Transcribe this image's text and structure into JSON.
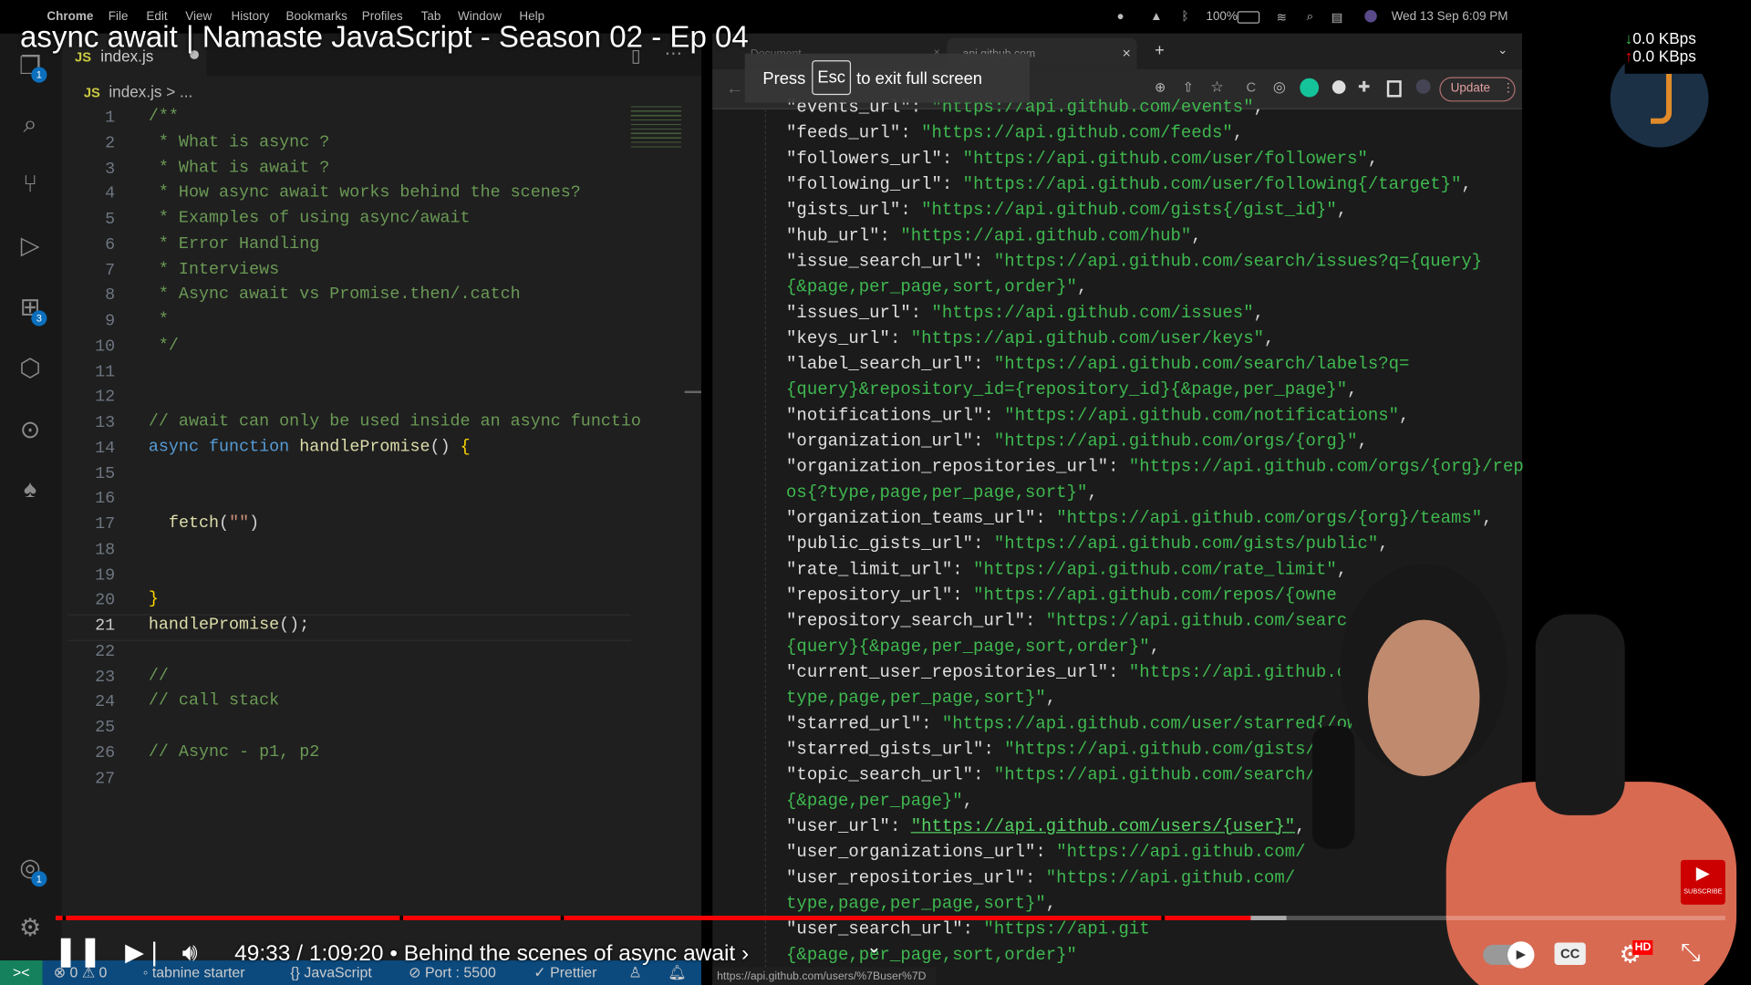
{
  "video": {
    "title": "async await | Namaste JavaScript - Season 02 - Ep 04",
    "time": "49:33 / 1:09:20",
    "chapter": "Behind the scenes of async await",
    "progress_percent": 71.6,
    "buffered_percent": 73.7,
    "accent": "#ff0000"
  },
  "menubar": {
    "items": [
      "Chrome",
      "File",
      "Edit",
      "View",
      "History",
      "Bookmarks",
      "Profiles",
      "Tab",
      "Window",
      "Help"
    ],
    "battery": "100%",
    "datetime": "Wed 13 Sep  6:09 PM"
  },
  "netspeed": {
    "down": "0.0 KBps",
    "up": "0.0 KBps"
  },
  "vscode": {
    "tab": "index.js",
    "tab_icon": "JS",
    "breadcrumb": "index.js > ...",
    "badges": {
      "explorer": "1",
      "extensions": "3",
      "accounts": "1"
    },
    "active_line": 21,
    "lines": [
      [
        [
          "/**",
          "comment"
        ]
      ],
      [
        [
          " * What is async ?",
          "comment"
        ]
      ],
      [
        [
          " * What is await ?",
          "comment"
        ]
      ],
      [
        [
          " * How async await works behind the scenes?",
          "comment"
        ]
      ],
      [
        [
          " * Examples of using async/await",
          "comment"
        ]
      ],
      [
        [
          " * Error Handling",
          "comment"
        ]
      ],
      [
        [
          " * Interviews",
          "comment"
        ]
      ],
      [
        [
          " * Async await vs Promise.then/.catch",
          "comment"
        ]
      ],
      [
        [
          " *",
          "comment"
        ]
      ],
      [
        [
          " */",
          "comment"
        ]
      ],
      [],
      [],
      [
        [
          "// await can only be used inside an async functio",
          "comment"
        ]
      ],
      [
        [
          "async",
          "kw"
        ],
        [
          " ",
          "plain"
        ],
        [
          "function",
          "kw"
        ],
        [
          " ",
          "plain"
        ],
        [
          "handlePromise",
          "fn"
        ],
        [
          "() ",
          "plain"
        ],
        [
          "{",
          "brace"
        ]
      ],
      [],
      [],
      [
        [
          "  ",
          "plain"
        ],
        [
          "fetch",
          "fn"
        ],
        [
          "(",
          "plain"
        ],
        [
          "\"\"",
          "str"
        ],
        [
          ")",
          "plain"
        ]
      ],
      [],
      [],
      [
        [
          "}",
          "brace"
        ]
      ],
      [
        [
          "handlePromise",
          "fn"
        ],
        [
          "();",
          "plain"
        ]
      ],
      [],
      [
        [
          "//",
          "comment"
        ]
      ],
      [
        [
          "// call stack",
          "comment"
        ]
      ],
      [],
      [
        [
          "// Async - p1, p2",
          "comment"
        ]
      ],
      []
    ],
    "status": {
      "remote": "><",
      "errors": "0",
      "warnings": "0",
      "tabnine": "tabnine starter",
      "language": "JavaScript",
      "port": "Port : 5500",
      "prettier": "Prettier"
    }
  },
  "chrome": {
    "tabs": [
      "Document",
      "api.github.com"
    ],
    "fullscreen_msg": {
      "press": "Press",
      "key": "Esc",
      "rest": "to exit full screen"
    },
    "update_label": "Update",
    "status_url": "https://api.github.com/users/%7Buser%7D",
    "json_lines": [
      {
        "k": "\"events_url\"",
        "v": "\"https://api.github.com/events\"",
        "t": ","
      },
      {
        "k": "\"feeds_url\"",
        "v": "\"https://api.github.com/feeds\"",
        "t": ","
      },
      {
        "k": "\"followers_url\"",
        "v": "\"https://api.github.com/user/followers\"",
        "t": ","
      },
      {
        "k": "\"following_url\"",
        "v": "\"https://api.github.com/user/following{/target}\"",
        "t": ","
      },
      {
        "k": "\"gists_url\"",
        "v": "\"https://api.github.com/gists{/gist_id}\"",
        "t": ","
      },
      {
        "k": "\"hub_url\"",
        "v": "\"https://api.github.com/hub\"",
        "t": ","
      },
      {
        "k": "\"issue_search_url\"",
        "v": "\"https://api.github.com/search/issues?q={query}",
        "t": ""
      },
      {
        "k": "",
        "v": "{&page,per_page,sort,order}\"",
        "t": ","
      },
      {
        "k": "\"issues_url\"",
        "v": "\"https://api.github.com/issues\"",
        "t": ","
      },
      {
        "k": "\"keys_url\"",
        "v": "\"https://api.github.com/user/keys\"",
        "t": ","
      },
      {
        "k": "\"label_search_url\"",
        "v": "\"https://api.github.com/search/labels?q=",
        "t": ""
      },
      {
        "k": "",
        "v": "{query}&repository_id={repository_id}{&page,per_page}\"",
        "t": ","
      },
      {
        "k": "\"notifications_url\"",
        "v": "\"https://api.github.com/notifications\"",
        "t": ","
      },
      {
        "k": "\"organization_url\"",
        "v": "\"https://api.github.com/orgs/{org}\"",
        "t": ","
      },
      {
        "k": "\"organization_repositories_url\"",
        "v": "\"https://api.github.com/orgs/{org}/rep",
        "t": ""
      },
      {
        "k": "",
        "v": "os{?type,page,per_page,sort}\"",
        "t": ","
      },
      {
        "k": "\"organization_teams_url\"",
        "v": "\"https://api.github.com/orgs/{org}/teams\"",
        "t": ","
      },
      {
        "k": "\"public_gists_url\"",
        "v": "\"https://api.github.com/gists/public\"",
        "t": ","
      },
      {
        "k": "\"rate_limit_url\"",
        "v": "\"https://api.github.com/rate_limit\"",
        "t": ","
      },
      {
        "k": "\"repository_url\"",
        "v": "\"https://api.github.com/repos/{owne",
        "t": ""
      },
      {
        "k": "\"repository_search_url\"",
        "v": "\"https://api.github.com/searc",
        "t": ""
      },
      {
        "k": "",
        "v": "{query}{&page,per_page,sort,order}\"",
        "t": ","
      },
      {
        "k": "\"current_user_repositories_url\"",
        "v": "\"https://api.github.co",
        "t": ""
      },
      {
        "k": "",
        "v": "type,page,per_page,sort}\"",
        "t": ","
      },
      {
        "k": "\"starred_url\"",
        "v": "\"https://api.github.com/user/starred{/owne",
        "t": ""
      },
      {
        "k": "\"starred_gists_url\"",
        "v": "\"https://api.github.com/gists/sta",
        "t": ""
      },
      {
        "k": "\"topic_search_url\"",
        "v": "\"https://api.github.com/search/t",
        "t": ""
      },
      {
        "k": "",
        "v": "{&page,per_page}\"",
        "t": ","
      },
      {
        "k": "\"user_url\"",
        "v": "\"https://api.github.com/users/{user}\"",
        "t": ",",
        "link": true
      },
      {
        "k": "\"user_organizations_url\"",
        "v": "\"https://api.github.com/",
        "t": ""
      },
      {
        "k": "\"user_repositories_url\"",
        "v": "\"https://api.github.com/",
        "t": ""
      },
      {
        "k": "",
        "v": "type,page,per_page,sort}\"",
        "t": ","
      },
      {
        "k": "\"user_search_url\"",
        "v": "\"https://api.git",
        "t": ""
      },
      {
        "k": "",
        "v": "{&page,per_page,sort,order}\"",
        "t": ""
      }
    ]
  },
  "youtube": {
    "subscribe": "SUBSCRIBE",
    "cc": "CC",
    "hd": "HD"
  }
}
